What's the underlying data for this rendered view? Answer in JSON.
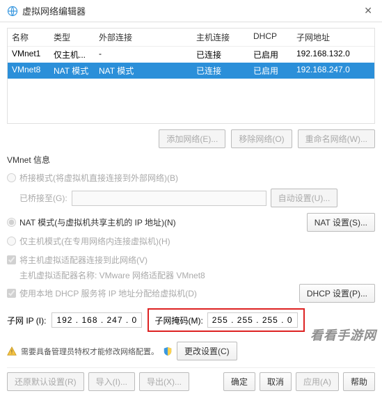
{
  "window": {
    "title": "虚拟网络编辑器",
    "close_tooltip": "关闭"
  },
  "table": {
    "headers": {
      "name": "名称",
      "type": "类型",
      "ext": "外部连接",
      "host": "主机连接",
      "dhcp": "DHCP",
      "subnet": "子网地址"
    },
    "rows": [
      {
        "name": "VMnet1",
        "type": "仅主机...",
        "ext": "-",
        "host": "已连接",
        "dhcp": "已启用",
        "subnet": "192.168.132.0",
        "selected": false
      },
      {
        "name": "VMnet8",
        "type": "NAT 模式",
        "ext": "NAT 模式",
        "host": "已连接",
        "dhcp": "已启用",
        "subnet": "192.168.247.0",
        "selected": true
      }
    ]
  },
  "actions": {
    "add": "添加网络(E)...",
    "remove": "移除网络(O)",
    "rename": "重命名网络(W)..."
  },
  "vmnet": {
    "section_title": "VMnet 信息",
    "bridge_radio": "桥接模式(将虚拟机直接连接到外部网络)(B)",
    "bridge_to_label": "已桥接至(G):",
    "bridge_auto_btn": "自动设置(U)...",
    "nat_radio": "NAT 模式(与虚拟机共享主机的 IP 地址)(N)",
    "nat_settings_btn": "NAT 设置(S)...",
    "hostonly_radio": "仅主机模式(在专用网络内连接虚拟机)(H)",
    "host_connect_check": "将主机虚拟适配器连接到此网络(V)",
    "adapter_label": "主机虚拟适配器名称: VMware 网络适配器 VMnet8",
    "dhcp_check": "使用本地 DHCP 服务将 IP 地址分配给虚拟机(D)",
    "dhcp_settings_btn": "DHCP 设置(P)...",
    "subnet_ip_label": "子网 IP (I):",
    "subnet_ip": "192 . 168 . 247 .  0",
    "subnet_mask_label": "子网掩码(M):",
    "subnet_mask": "255 . 255 . 255 .  0"
  },
  "info": {
    "admin_text": "需要具备管理员特权才能修改网络配置。",
    "change_settings_btn": "更改设置(C)"
  },
  "bottom": {
    "restore": "还原默认设置(R)",
    "import": "导入(I)...",
    "export": "导出(X)...",
    "ok": "确定",
    "cancel": "取消",
    "apply": "应用(A)",
    "help": "帮助"
  },
  "watermark": "看看手游网"
}
